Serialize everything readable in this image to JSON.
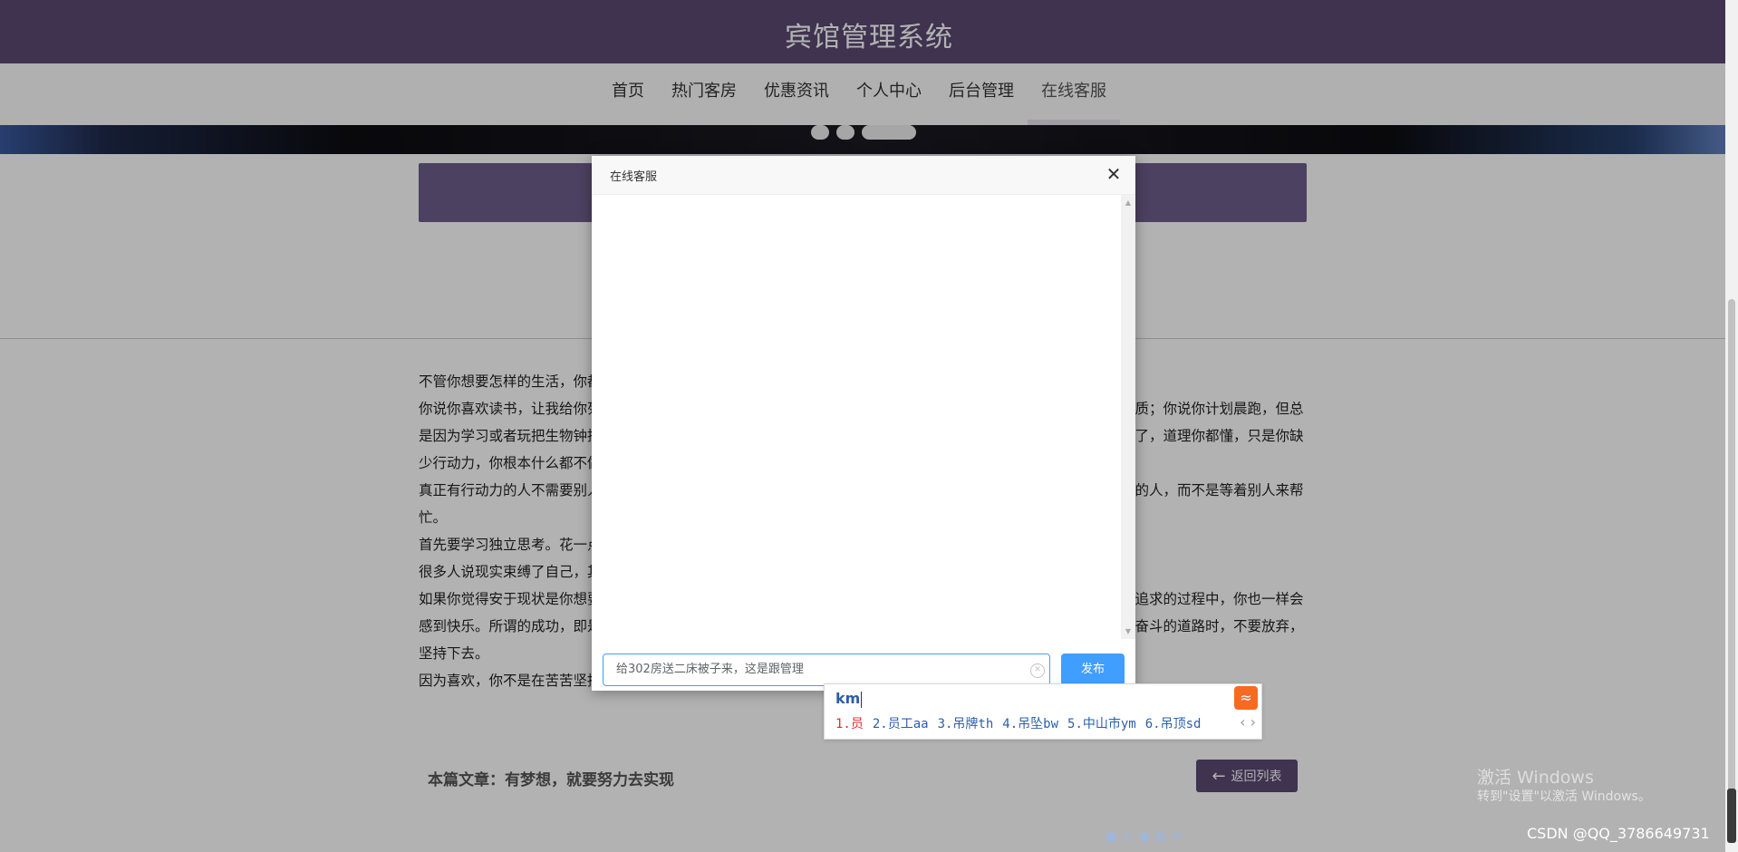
{
  "site": {
    "title": "宾馆管理系统"
  },
  "nav": [
    "首页",
    "热门客房",
    "优惠资讯",
    "个人中心",
    "后台管理",
    "在线客服"
  ],
  "article": {
    "paragraphs": [
      "不管你想要怎样的生活，你都要努力，不管你想成为怎样的人，你都要去尝试，去行动。",
      "你说你喜欢读书，让我给你列个书单，你还问我哪里有那么多时间看书；你说自己想成为一个文案，应该具备哪些素质；你说你计划晨跑，但总是因为学习或者玩把生物钟搞乱；你说你想来一场长途旅行，但是没钱，父母觉得危险。其实，我已经不用再给你说了，道理你都懂，只是你缺少行动力，你根本什么都不做。",
      "真正有行动力的人不需要别人督促，他们会主动规划自己的生活，遇到问题，会主动去解决或者主动寻求可以帮助他的人，而不是等着别人来帮忙。",
      "首先要学习独立思考。花一点时间想想自己想要什么样的生活，是事业有成，还是环游世界。",
      "很多人说现实束缚了自己，其实生活没有想象中那么难，也没有你想象中那么简单，只是我们缺乏行动力而已。",
      "如果你觉得安于现状是你想要的，那选择安于现状就会让你幸福和满足；如果你不甘平庸，选择奋斗的道路，在这个追求的过程中，你也一样会感到快乐。所谓的成功，即是按照自己想要的生活方式生活。最重要的是，你想要选择一条不甘平庸、改变、进取和奋斗的道路时，不要放弃，坚持下去。",
      "因为喜欢，你不是在苦苦坚持，也因为喜欢，你愿意投入时间、精力，长久以往，获得成功就是自然而然的事情。"
    ],
    "caption": "本篇文章：有梦想，就要努力去实现",
    "back_label": "返回列表"
  },
  "dialog": {
    "title": "在线客服",
    "input_value": "给302房送二床被子来，这是跟管理",
    "send_label": "发布"
  },
  "ime": {
    "input": "km",
    "candidates": [
      "1.员",
      "2.员工aa",
      "3.吊牌th",
      "4.吊坠bw",
      "5.中山市ym",
      "6.吊顶sd"
    ]
  },
  "watermark": {
    "line1": "激活 Windows",
    "line2": "转到\"设置\"以激活 Windows。"
  },
  "csdn": "CSDN @QQ_3786649731"
}
